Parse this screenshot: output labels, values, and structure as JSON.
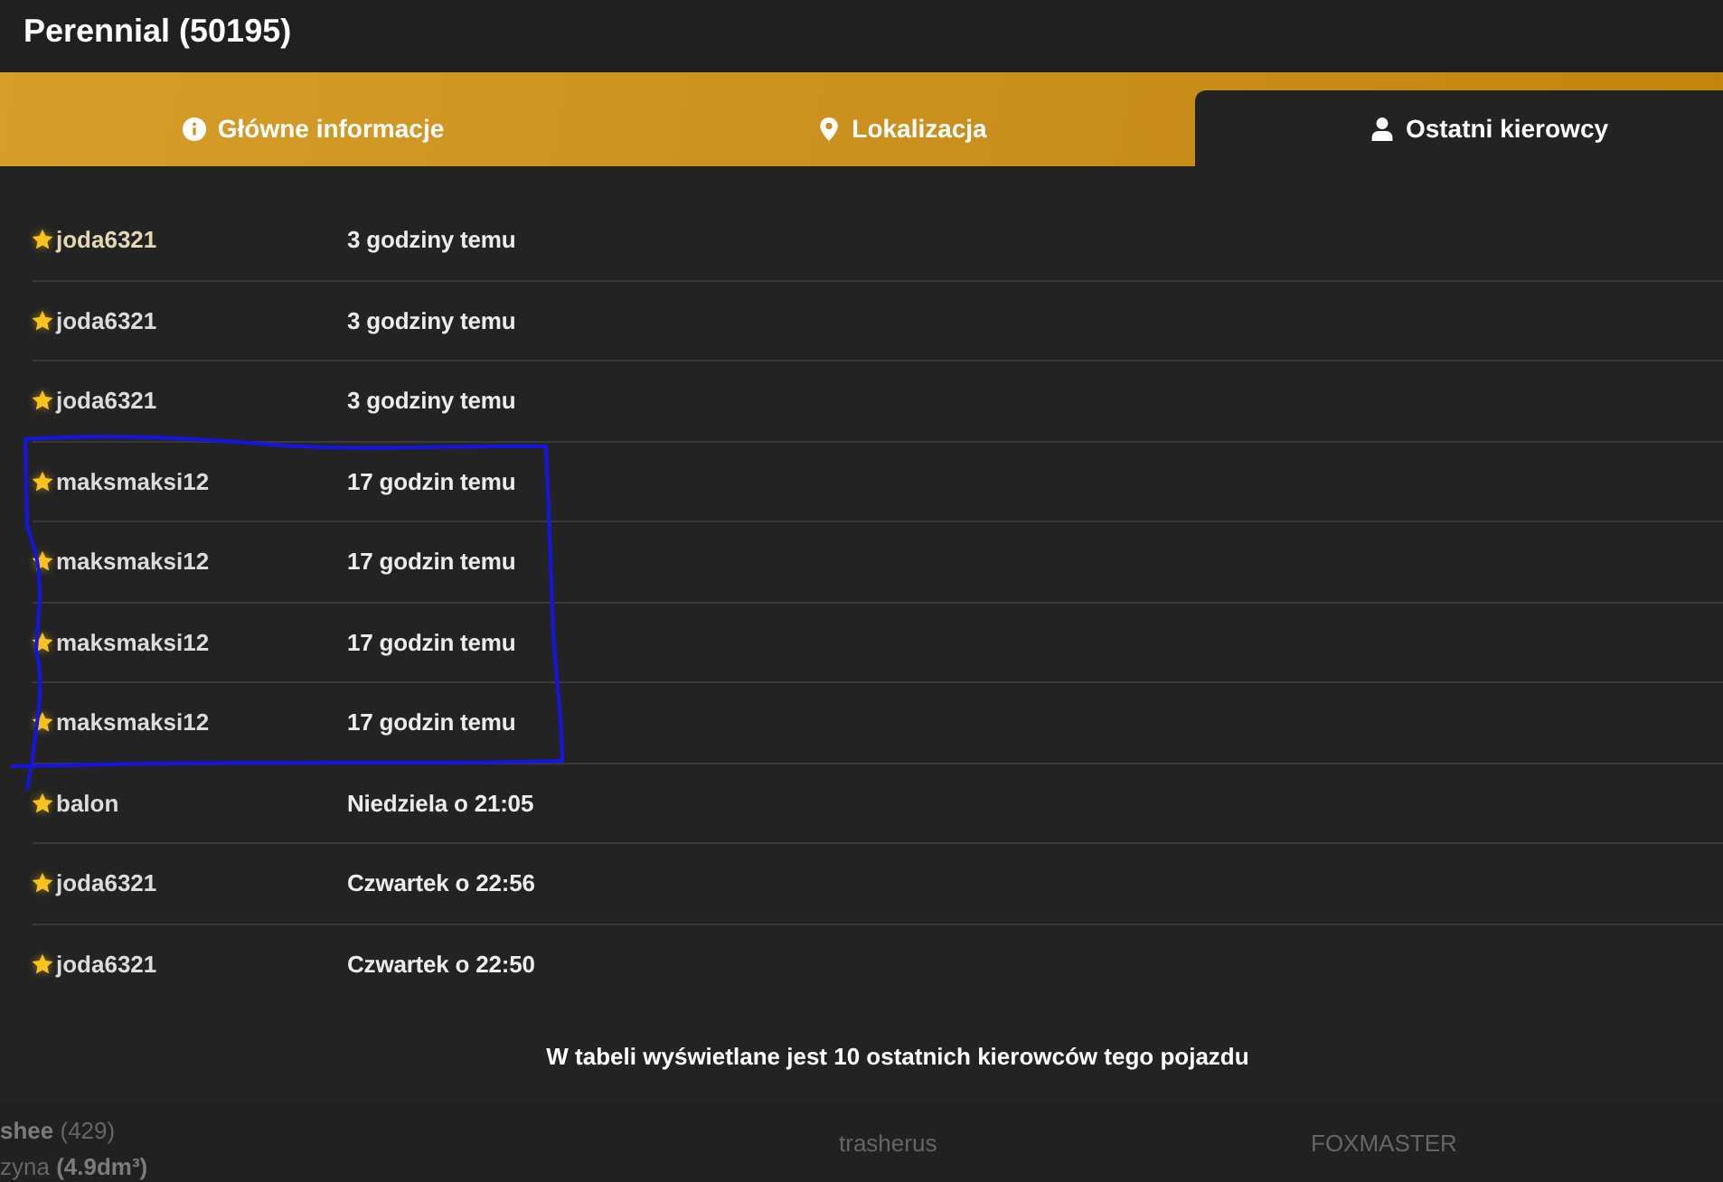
{
  "header": {
    "title": "Perennial (50195)"
  },
  "tabs": [
    {
      "label": "Główne informacje",
      "selected": false
    },
    {
      "label": "Lokalizacja",
      "selected": false
    },
    {
      "label": "Ostatni kierowcy",
      "selected": true
    }
  ],
  "drivers": {
    "rows": [
      {
        "name": "joda6321",
        "time": "3 godziny temu",
        "starred": true,
        "highlighted": true
      },
      {
        "name": "joda6321",
        "time": "3 godziny temu",
        "starred": true,
        "highlighted": false
      },
      {
        "name": "joda6321",
        "time": "3 godziny temu",
        "starred": true,
        "highlighted": false
      },
      {
        "name": "maksmaksi12",
        "time": "17 godzin temu",
        "starred": true,
        "highlighted": false
      },
      {
        "name": "maksmaksi12",
        "time": "17 godzin temu",
        "starred": true,
        "highlighted": false
      },
      {
        "name": "maksmaksi12",
        "time": "17 godzin temu",
        "starred": true,
        "highlighted": false
      },
      {
        "name": "maksmaksi12",
        "time": "17 godzin temu",
        "starred": true,
        "highlighted": false
      },
      {
        "name": "balon",
        "time": "Niedziela o 21:05",
        "starred": true,
        "highlighted": false
      },
      {
        "name": "joda6321",
        "time": "Czwartek o 22:56",
        "starred": true,
        "highlighted": false
      },
      {
        "name": "joda6321",
        "time": "Czwartek o 22:50",
        "starred": true,
        "highlighted": false
      }
    ],
    "note": "W tabeli wyświetlane jest 10 ostatnich kierowców tego pojazdu"
  },
  "background_page": {
    "left_lines": [
      "**shee** (429)",
      "zyna **(4.9dm³)**"
    ],
    "names": [
      "trasherus",
      "FOXMASTER"
    ]
  }
}
